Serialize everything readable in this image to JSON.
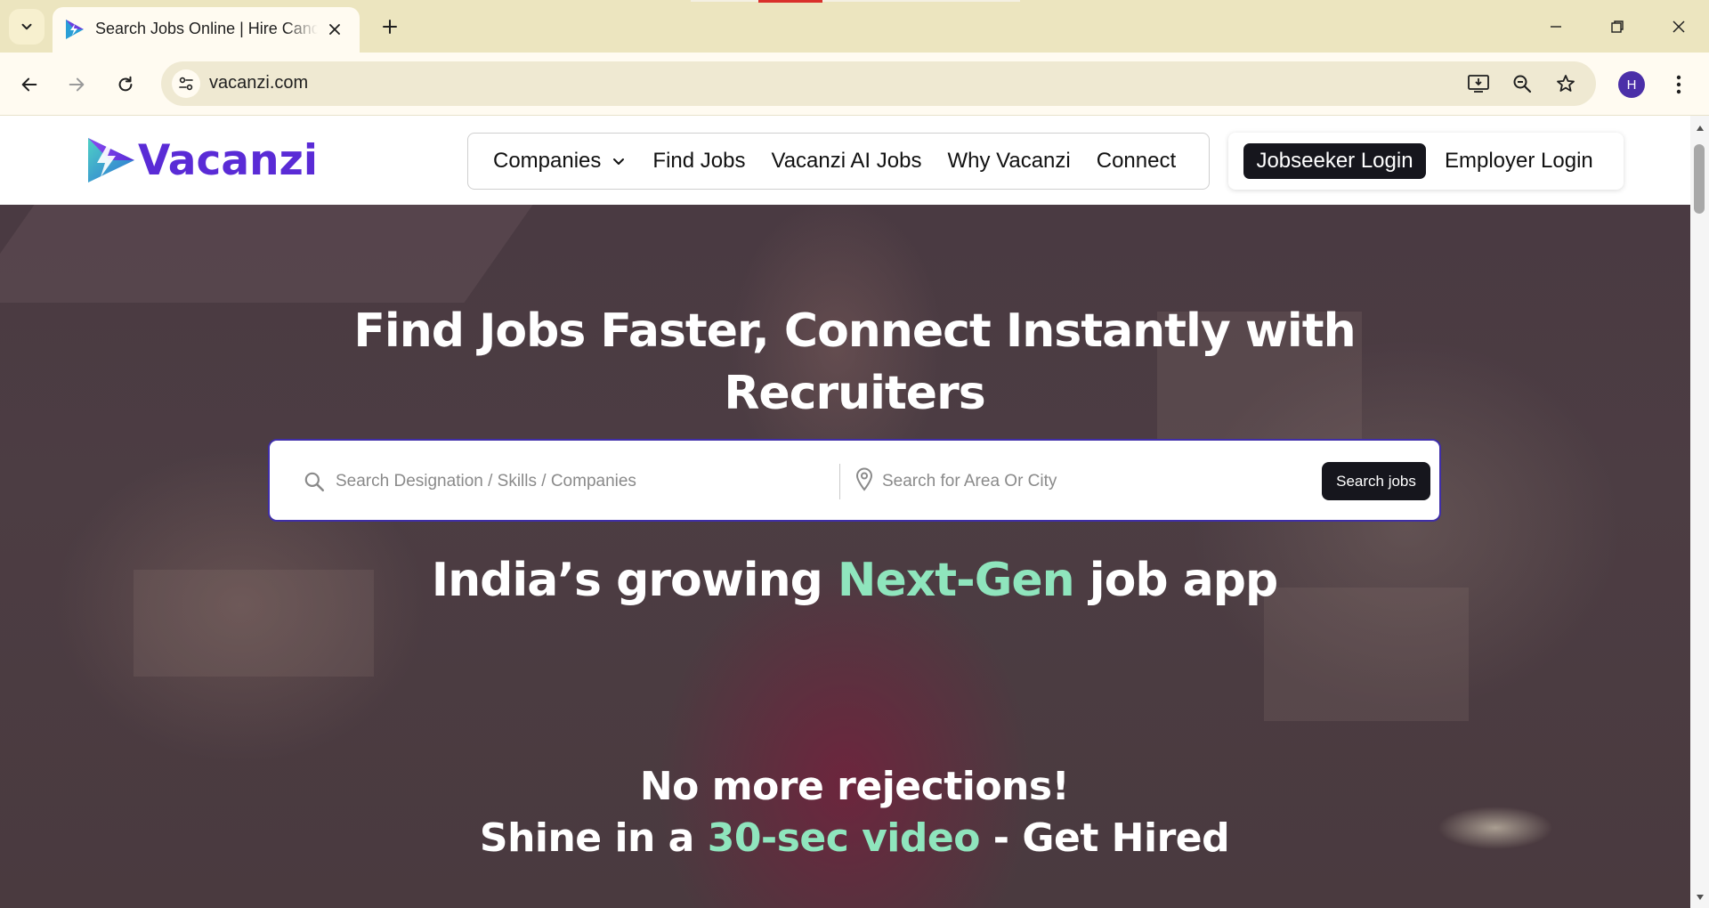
{
  "browser": {
    "tab_title": "Search Jobs Online | Hire Candidates",
    "url": "vacanzi.com",
    "profile_initial": "H"
  },
  "site": {
    "logo_text": "Vacanzi",
    "brand_color": "#5a2bd6",
    "nav": {
      "companies": "Companies",
      "find_jobs": "Find Jobs",
      "ai_jobs": "Vacanzi AI Jobs",
      "why": "Why Vacanzi",
      "connect": "Connect"
    },
    "auth": {
      "jobseeker_login": "Jobseeker Login",
      "employer_login": "Employer Login"
    }
  },
  "hero": {
    "title_line1": "Find Jobs Faster, Connect Instantly with",
    "title_line2": "Recruiters",
    "search": {
      "keyword_placeholder": "Search Designation / Skills / Companies",
      "location_placeholder": "Search for Area Or City",
      "button_label": "Search jobs"
    },
    "tagline": {
      "prefix": "India’s growing ",
      "highlight": "Next-Gen",
      "suffix": " job app"
    },
    "promo": {
      "line1": "No more rejections!",
      "line2_prefix": "Shine in a ",
      "line2_highlight": "30-sec video",
      "line2_suffix": " - Get Hired"
    },
    "accent_color": "#8fe5bd"
  }
}
